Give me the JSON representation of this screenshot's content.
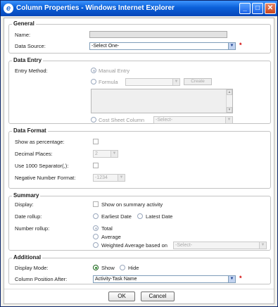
{
  "window": {
    "title": "Column Properties - Windows Internet Explorer",
    "minimize": "_",
    "maximize": "□",
    "close": "✕"
  },
  "general": {
    "legend": "General",
    "name_label": "Name:",
    "name_value": "",
    "data_source_label": "Data Source:",
    "data_source_value": "-Select One-",
    "required_mark": "*"
  },
  "data_entry": {
    "legend": "Data Entry",
    "entry_method_label": "Entry Method:",
    "manual_entry": "Manual Entry",
    "formula": "Formula",
    "formula_select_value": "",
    "create_button": "Create",
    "cost_sheet_column": "Cost Sheet Column",
    "cost_sheet_select_value": "-Select-"
  },
  "data_format": {
    "legend": "Data Format",
    "show_percentage_label": "Show as percentage:",
    "decimal_places_label": "Decimal Places:",
    "decimal_places_value": "2",
    "separator_label": "Use 1000 Separator(,):",
    "negative_format_label": "Negative Number Format:",
    "negative_format_value": "-1234"
  },
  "summary": {
    "legend": "Summary",
    "display_label": "Display:",
    "show_on_summary": "Show on summary activity",
    "date_rollup_label": "Date rollup:",
    "earliest_date": "Earliest Date",
    "latest_date": "Latest Date",
    "number_rollup_label": "Number rollup:",
    "total": "Total",
    "average": "Average",
    "weighted_average": "Weighted Average based on",
    "weighted_select_value": "-Select-"
  },
  "additional": {
    "legend": "Additional",
    "display_mode_label": "Display Mode:",
    "show": "Show",
    "hide": "Hide",
    "column_position_label": "Column Position After:",
    "column_position_value": "Activity-Task Name",
    "required_mark": "*"
  },
  "buttons": {
    "ok": "OK",
    "cancel": "Cancel"
  }
}
